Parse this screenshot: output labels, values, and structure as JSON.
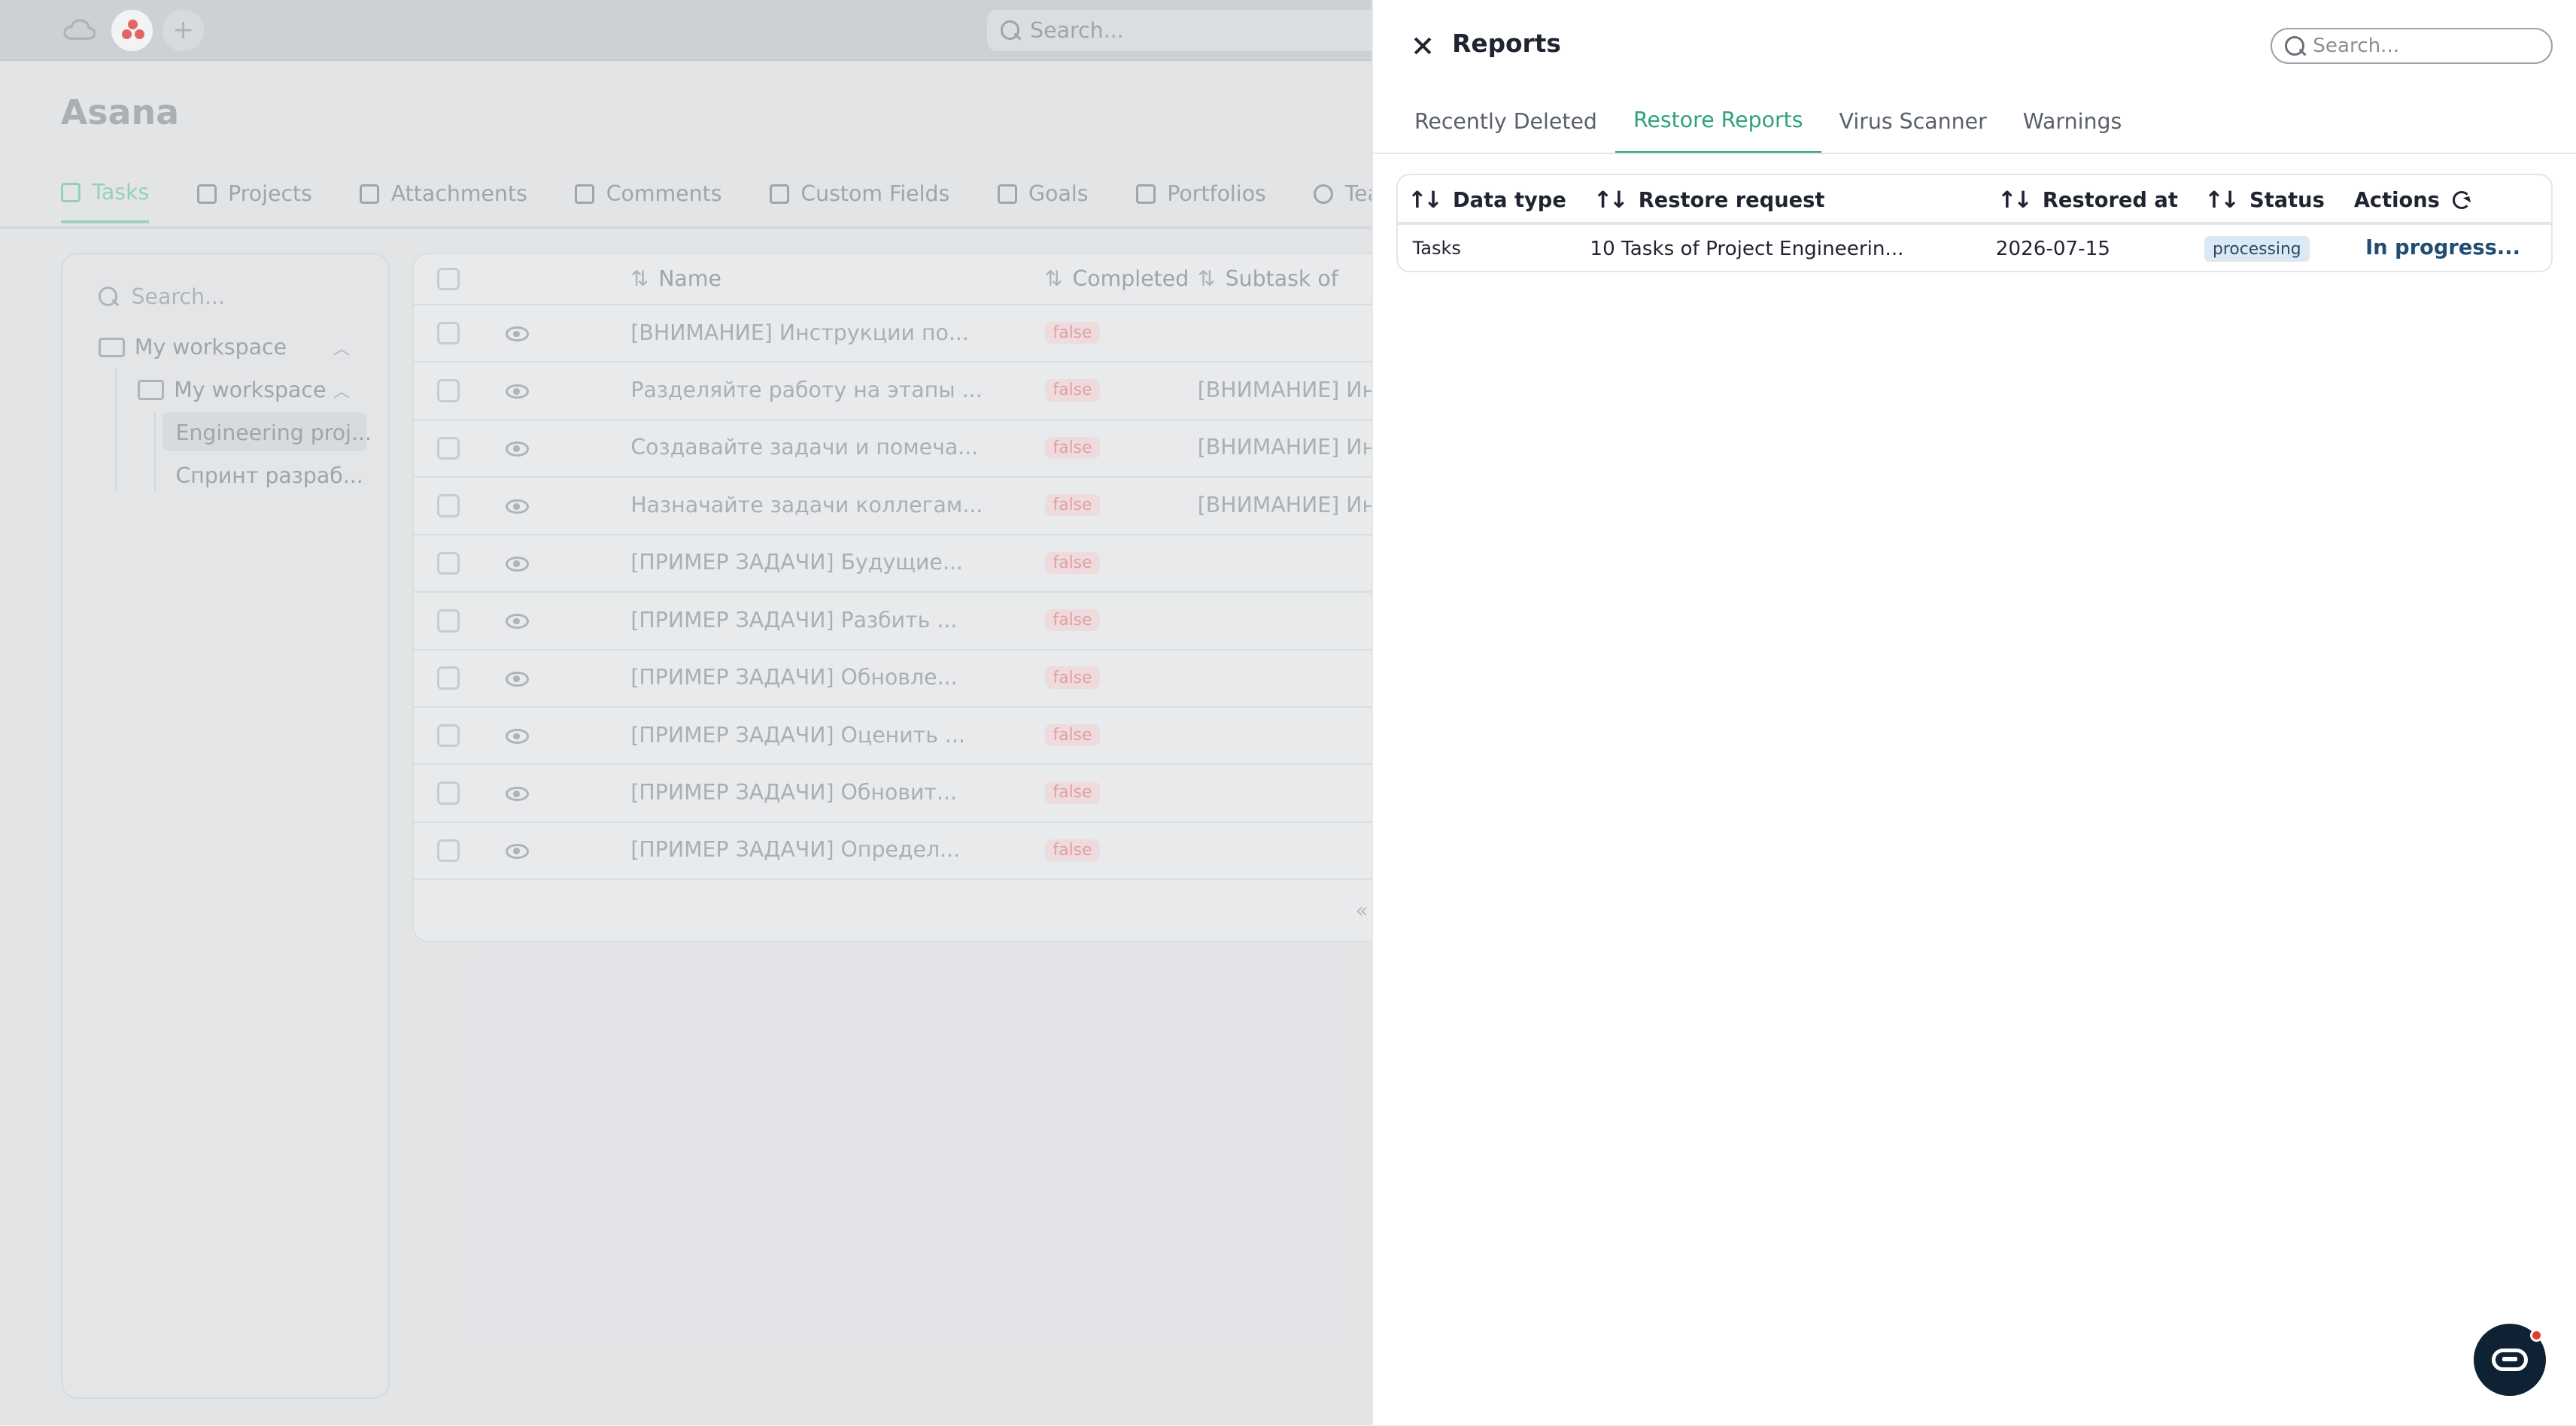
{
  "background": {
    "app_title": "Asana",
    "top_search_placeholder": "Search...",
    "tabs": [
      {
        "label": "Tasks"
      },
      {
        "label": "Projects"
      },
      {
        "label": "Attachments"
      },
      {
        "label": "Comments"
      },
      {
        "label": "Custom Fields"
      },
      {
        "label": "Goals"
      },
      {
        "label": "Portfolios"
      },
      {
        "label": "Team"
      }
    ],
    "sidebar": {
      "search_placeholder": "Search...",
      "items": [
        {
          "label": "My workspace"
        },
        {
          "label": "My workspace"
        },
        {
          "label": "Engineering proj..."
        },
        {
          "label": "Спринт разраб..."
        }
      ]
    },
    "grid": {
      "columns": [
        "Name",
        "Completed",
        "Subtask of"
      ],
      "rows": [
        {
          "name": "[ВНИМАНИЕ] Инструкции по...",
          "completed": "false",
          "subtask_of": ""
        },
        {
          "name": "Разделяйте работу на этапы ...",
          "completed": "false",
          "subtask_of": "[ВНИМАНИЕ] Инс"
        },
        {
          "name": "Создавайте задачи и помеча...",
          "completed": "false",
          "subtask_of": "[ВНИМАНИЕ] Инс"
        },
        {
          "name": "Назначайте задачи коллегам...",
          "completed": "false",
          "subtask_of": "[ВНИМАНИЕ] Инс"
        },
        {
          "name": "[ПРИМЕР ЗАДАЧИ] Будущие...",
          "completed": "false",
          "subtask_of": ""
        },
        {
          "name": "[ПРИМЕР ЗАДАЧИ] Разбить ...",
          "completed": "false",
          "subtask_of": ""
        },
        {
          "name": "[ПРИМЕР ЗАДАЧИ] Обновле...",
          "completed": "false",
          "subtask_of": ""
        },
        {
          "name": "[ПРИМЕР ЗАДАЧИ] Оценить ...",
          "completed": "false",
          "subtask_of": ""
        },
        {
          "name": "[ПРИМЕР ЗАДАЧИ] Обновит...",
          "completed": "false",
          "subtask_of": ""
        },
        {
          "name": "[ПРИМЕР ЗАДАЧИ] Определ...",
          "completed": "false",
          "subtask_of": ""
        }
      ],
      "pager": "«"
    }
  },
  "drawer": {
    "title": "Reports",
    "search_placeholder": "Search...",
    "tabs": [
      {
        "label": "Recently Deleted"
      },
      {
        "label": "Restore Reports"
      },
      {
        "label": "Virus Scanner"
      },
      {
        "label": "Warnings"
      }
    ],
    "active_tab": "Restore Reports",
    "table": {
      "columns": {
        "data_type": "Data type",
        "restore_request": "Restore request",
        "restored_at": "Restored at",
        "status": "Status",
        "actions": "Actions"
      },
      "rows": [
        {
          "data_type": "Tasks",
          "restore_request": "10 Tasks of Project Engineerin...",
          "restored_at": "2026-07-15",
          "status": "processing",
          "action": "In progress..."
        }
      ]
    }
  },
  "colors": {
    "accent_green": "#2fa27a",
    "status_badge_bg": "#dbe9f5",
    "action_link": "#1f4d73",
    "chat_button": "#0e2233",
    "notification_dot": "#e53935"
  }
}
